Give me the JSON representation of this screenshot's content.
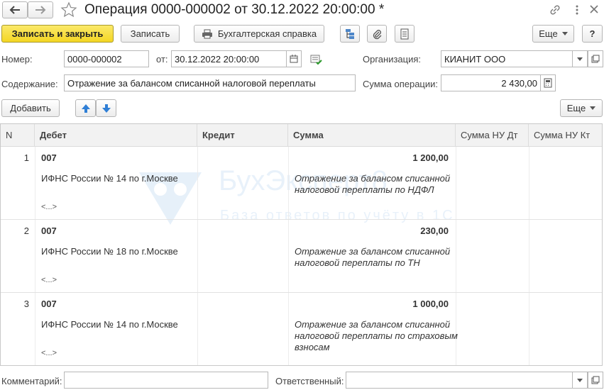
{
  "window": {
    "title": "Операция 0000-000002 от 30.12.2022 20:00:00 *"
  },
  "toolbar": {
    "save_close_label": "Записать и закрыть",
    "save_label": "Записать",
    "report_label": "Бухгалтерская справка",
    "more_label": "Еще",
    "help_label": "?"
  },
  "form": {
    "number_label": "Номер:",
    "number_value": "0000-000002",
    "date_label": "от:",
    "date_value": "30.12.2022 20:00:00",
    "org_label": "Организация:",
    "org_value": "КИАНИТ ООО",
    "content_label": "Содержание:",
    "content_value": "Отражение за балансом списанной налоговой переплаты",
    "sum_label": "Сумма операции:",
    "sum_value": "2 430,00"
  },
  "table_toolbar": {
    "add_label": "Добавить",
    "more_label": "Еще"
  },
  "table": {
    "columns": [
      "N",
      "Дебет",
      "Кредит",
      "Сумма",
      "Сумма НУ Дт",
      "Сумма НУ Кт"
    ],
    "rows": [
      {
        "n": "1",
        "account": "007",
        "amount": "1 200,00",
        "subconto": "ИФНС России № 14 по г.Москве",
        "description": "Отражение за балансом списанной налоговой переплаты по НДФЛ",
        "dots": "<...>"
      },
      {
        "n": "2",
        "account": "007",
        "amount": "230,00",
        "subconto": "ИФНС России № 18 по г.Москве",
        "description": "Отражение за балансом списанной налоговой переплаты по ТН",
        "dots": "<...>"
      },
      {
        "n": "3",
        "account": "007",
        "amount": "1 000,00",
        "subconto": "ИФНС России № 14 по г.Москве",
        "description": "Отражение за балансом списанной налоговой переплаты по страховым взносам",
        "dots": "<...>"
      }
    ]
  },
  "footer": {
    "comment_label": "Комментарий:",
    "comment_value": "",
    "responsible_label": "Ответственный:",
    "responsible_value": ""
  },
  "watermark": {
    "brand": "БухЭксперт8",
    "tagline": "База ответов по учёту в 1С"
  },
  "colors": {
    "primary_button": "#f4d623",
    "arrow_blue": "#2f7fd6",
    "watermark": "#4a90d9"
  }
}
